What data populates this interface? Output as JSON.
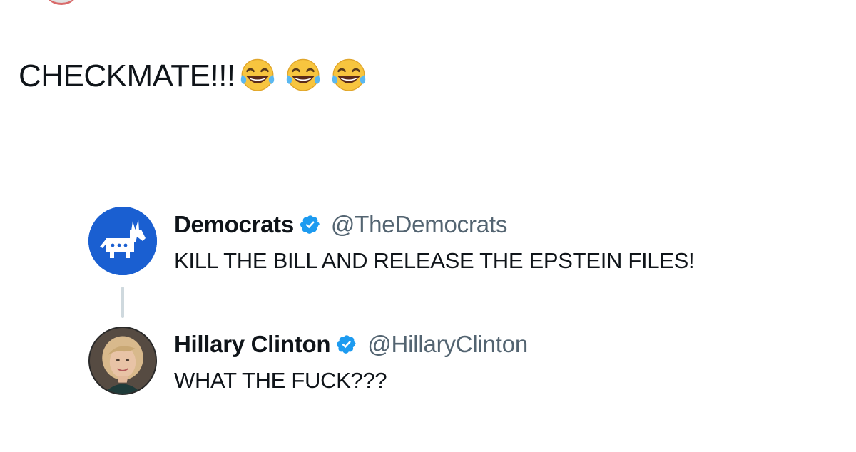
{
  "post": {
    "text": "CHECKMATE!!!",
    "emojis": [
      "face-with-tears-of-joy-icon",
      "face-with-tears-of-joy-icon",
      "face-with-tears-of-joy-icon"
    ]
  },
  "quoted_thread": [
    {
      "name": "Democrats",
      "handle": "@TheDemocrats",
      "verified": true,
      "avatar_icon": "democratic-donkey-logo-icon",
      "avatar_color": "#1a5fd1",
      "text": "KILL THE BILL AND RELEASE THE EPSTEIN FILES!"
    },
    {
      "name": "Hillary Clinton",
      "handle": "@HillaryClinton",
      "verified": true,
      "avatar_icon": "profile-photo",
      "text": "WHAT THE FUCK???"
    }
  ],
  "colors": {
    "verified": "#1d9bf0",
    "handle": "#536471",
    "text": "#0f1419",
    "thread_line": "#cfd9de"
  }
}
